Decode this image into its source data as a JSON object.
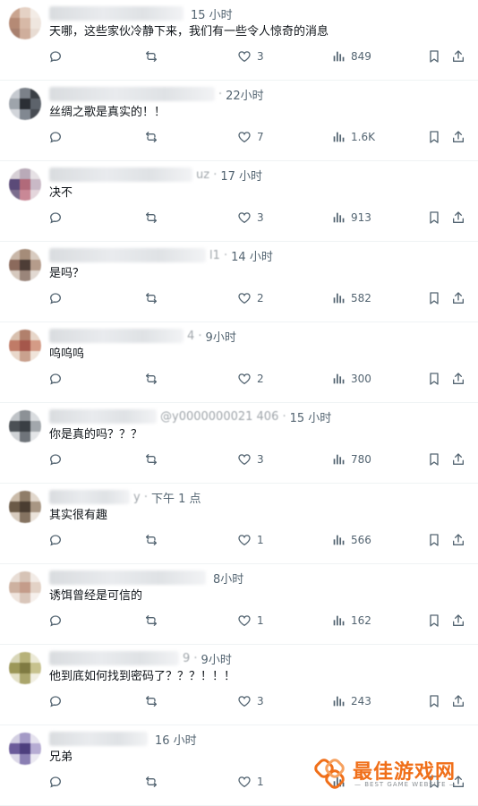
{
  "replies": [
    {
      "time": "15 小时",
      "name_frag": "",
      "text": "天哪，这些家伙冷静下来，我们有一些令人惊奇的消息",
      "likes": "3",
      "views": "849",
      "avatar": [
        "#c9a48f",
        "#e5d2c5",
        "#f3ece6",
        "#b58a75",
        "#d7b9a7",
        "#efe6df",
        "#a8806e",
        "#cfae9c",
        "#e8dcd3"
      ]
    },
    {
      "time": "22小时",
      "name_frag": "· ",
      "text": "丝绸之歌是真实的！！",
      "likes": "7",
      "views": "1.6K",
      "avatar": [
        "#c6cad0",
        "#7b8189",
        "#3a3f45",
        "#9ea4ab",
        "#2b2f35",
        "#5d636b",
        "#d2d5da",
        "#818891",
        "#474c53"
      ]
    },
    {
      "time": "17 小时",
      "name_frag": "uz ·",
      "text": "决不",
      "likes": "3",
      "views": "913",
      "avatar": [
        "#d7d0d6",
        "#b9aab8",
        "#e6e1e5",
        "#5b4a78",
        "#b16a7a",
        "#c9b9c6",
        "#7b6d8d",
        "#c98896",
        "#e4d6dc"
      ]
    },
    {
      "time": "14 小时",
      "name_frag": "l1 ·",
      "text": "是吗？",
      "likes": "2",
      "views": "582",
      "avatar": [
        "#c9b7a8",
        "#a58c79",
        "#d8cbc0",
        "#8b6a5c",
        "#4d3d36",
        "#b59c8b",
        "#d6c9be",
        "#9a857a",
        "#e2d9d2"
      ]
    },
    {
      "time": "9小时",
      "name_frag": "4 ·",
      "text": "呜呜呜",
      "likes": "2",
      "views": "300",
      "avatar": [
        "#d8c0ae",
        "#b1806c",
        "#e7d6c9",
        "#c07b67",
        "#a5574b",
        "#d49b86",
        "#e9d8cb",
        "#c9a18e",
        "#f0e4da"
      ]
    },
    {
      "time": "15 小时",
      "name_frag": "@y0000000021 406 ·",
      "text": "你是真的吗？？？",
      "likes": "3",
      "views": "780",
      "avatar": [
        "#bfc3c7",
        "#8c9196",
        "#d9dcdf",
        "#4b5055",
        "#3a3f44",
        "#a2a7ac",
        "#d0d3d6",
        "#6f747a",
        "#e3e5e7"
      ]
    },
    {
      "time": "下午 1 点",
      "name_frag": "y ·",
      "text": "其实很有趣",
      "likes": "1",
      "views": "566",
      "avatar": [
        "#cabba9",
        "#8f7d68",
        "#e1d7cc",
        "#6b5a47",
        "#4a3d31",
        "#a89683",
        "#d8ccbf",
        "#857361",
        "#ebe3da"
      ]
    },
    {
      "time": "8小时",
      "name_frag": "",
      "text": "诱饵曾经是可信的",
      "likes": "1",
      "views": "162",
      "avatar": [
        "#e8ddd5",
        "#d6c3b6",
        "#f2ebe6",
        "#cdb1a0",
        "#c49c8a",
        "#e3d2c6",
        "#efe5de",
        "#d9c6ba",
        "#f6f0ec"
      ]
    },
    {
      "time": "9小时",
      "name_frag": "9 ·",
      "text": "他到底如何找到密码了？？？！！！",
      "likes": "3",
      "views": "243",
      "avatar": [
        "#d8d6b8",
        "#b7b27a",
        "#ebe9d6",
        "#9c9758",
        "#7f7a42",
        "#c7c28e",
        "#e4e1c8",
        "#aaa56c",
        "#f1efe2"
      ]
    },
    {
      "time": "16 小时",
      "name_frag": "",
      "text": "兄弟",
      "likes": "1",
      "views": "",
      "avatar": [
        "#d3cfe2",
        "#a49ac6",
        "#e5e2ee",
        "#6b5b9a",
        "#4d3f7e",
        "#b6acd3",
        "#dcd8e8",
        "#8a7fb3",
        "#ebe9f2"
      ]
    }
  ],
  "watermark": {
    "cn": "最佳游戏网",
    "en": "— BEST GAME WEBSITE —"
  },
  "colors": {
    "text": "#0f1419",
    "muted": "#536471",
    "divider": "#eff3f4",
    "brand": "#f06f19"
  }
}
